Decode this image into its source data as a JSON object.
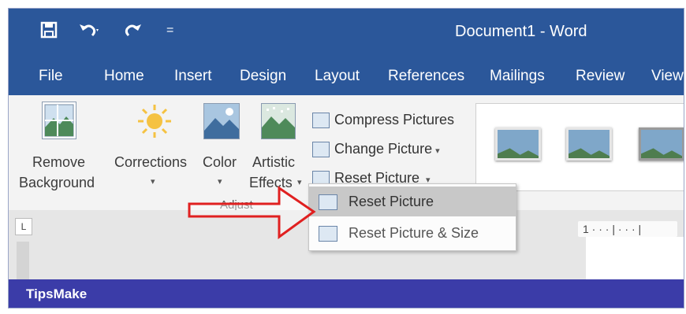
{
  "window": {
    "title": "Document1  -  Word"
  },
  "qat": {
    "save_icon": "save-icon",
    "undo_icon": "undo-icon",
    "redo_icon": "redo-icon",
    "customize": "="
  },
  "tabs": [
    "File",
    "Home",
    "Insert",
    "Design",
    "Layout",
    "References",
    "Mailings",
    "Review",
    "View"
  ],
  "ribbon": {
    "remove_bg": [
      "Remove",
      "Background"
    ],
    "corrections": "Corrections",
    "color": "Color",
    "artistic": [
      "Artistic",
      "Effects"
    ],
    "compress": "Compress Pictures",
    "change": "Change Picture",
    "reset": "Reset Picture",
    "group_label": "Adjust"
  },
  "menu": {
    "items": [
      "Reset Picture",
      "Reset Picture & Size"
    ]
  },
  "ruler": {
    "start": "1 · · · | · · · |"
  },
  "footer": {
    "brand": "TipsMake"
  },
  "colors": {
    "accent": "#2b579a",
    "footer": "#3b3ca8",
    "arrow": "#e02020"
  }
}
